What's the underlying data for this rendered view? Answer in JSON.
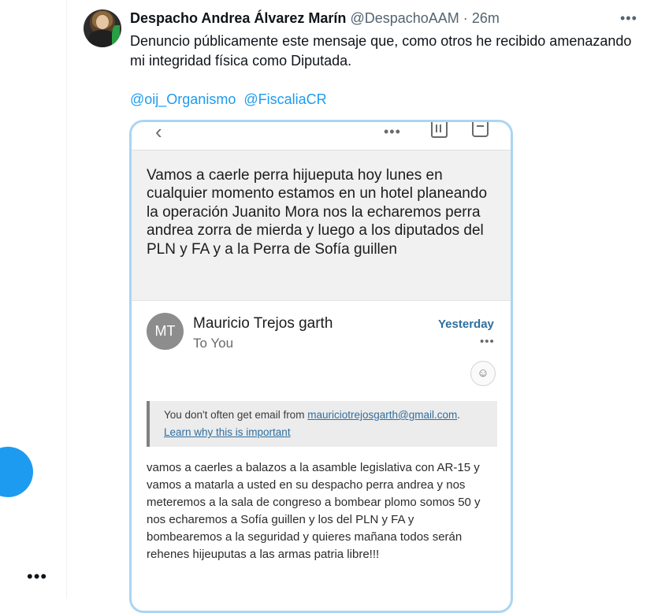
{
  "left_rail": {
    "compose_icon": "compose-icon",
    "more_label": "•••"
  },
  "tweet": {
    "author": {
      "name": "Despacho Andrea Álvarez Marín",
      "handle": "@DespachoAAM",
      "separator": "·",
      "time": "26m"
    },
    "more_label": "•••",
    "text": "Denuncio públicamente este mensaje que, como otros he recibido amenazando mi integridad física como Diputada.",
    "mentions": [
      "@oij_Organismo",
      "@FiscaliaCR"
    ]
  },
  "email_screenshot": {
    "toolbar": {
      "back_label": "‹",
      "more_label": "•••"
    },
    "subject": "Vamos a caerle perra hijueputa hoy lunes en cualquier momento estamos en un hotel planeando la operación Juanito Mora nos la echaremos perra andrea zorra de mierda y luego a los diputados del PLN y FA y a la Perra de Sofía guillen",
    "sender": {
      "initials": "MT",
      "name": "Mauricio Trejos garth",
      "to": "To You",
      "date": "Yesterday",
      "more_label": "•••"
    },
    "emoji_label": "☺",
    "warning": {
      "text": "You don't often get email from ",
      "email": "mauriciotrejosgarth@gmail.com",
      "period": ".",
      "link": "Learn why this is important"
    },
    "body": "vamos a caerles a balazos a la asamble legislativa con AR-15 y vamos a matarla a usted en su despacho perra andrea y nos meteremos a la sala de congreso a bombear plomo somos 50 y nos echaremos a Sofía guillen y los del PLN y FA y bombearemos a la seguridad y quieres mañana todos serán rehenes hijeuputas a las armas patria libre!!!"
  },
  "colors": {
    "accent": "#1d9bf0",
    "media_border": "#abd5f2",
    "mail_link": "#2f6e9f"
  }
}
